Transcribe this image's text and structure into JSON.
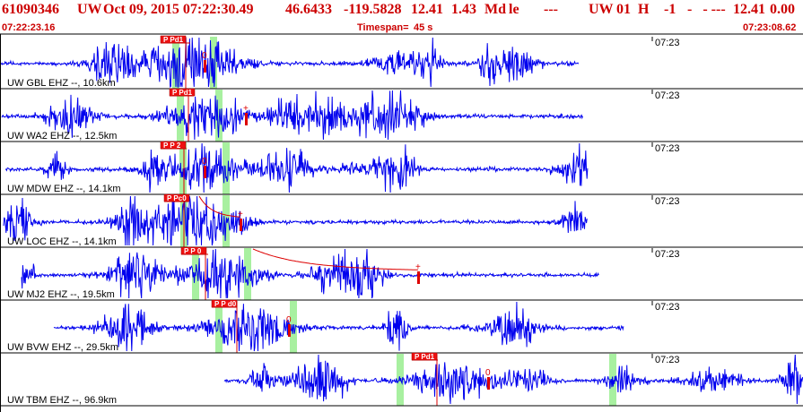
{
  "header": {
    "event_id": "61090346",
    "network": "UW",
    "datetime": "Oct 09, 2015 07:22:30.49",
    "latitude": "46.6433",
    "longitude": "-119.5828",
    "depth": "12.41",
    "magnitude": "1.43",
    "magnitude_type": "Md",
    "status": "le",
    "dashes1": "---",
    "source": "UW",
    "version": "01",
    "type": "H",
    "value1": "-1",
    "dash_group": "-   - ---",
    "depth2": "12.41",
    "value2": "0.00",
    "start_time": "07:22:23.16",
    "timespan_label": "Timespan=",
    "timespan_value": "45 s",
    "end_time": "07:23:08.62"
  },
  "colors": {
    "header_text": "#cc0000",
    "trace": "#0000ee",
    "pick": "#dd0000",
    "pick_label_bg": "#ee1111",
    "window_green": "#a8f0a0",
    "border": "#000000",
    "label_text": "#000000"
  },
  "channels": [
    {
      "label": "UW GBL EHZ --, 10.6km",
      "time_mark": "07:23",
      "pick_label": "P Pd1",
      "coda_marker": "0",
      "has_coda_curve": false,
      "has_plus": false
    },
    {
      "label": "UW WA2 EHZ --, 12.5km",
      "time_mark": "07:23",
      "pick_label": "P Pd1",
      "coda_marker": "+",
      "has_coda_curve": false,
      "has_plus": true
    },
    {
      "label": "UW MDW EHZ --, 14.1km",
      "time_mark": "07:23",
      "pick_label": "P P 2",
      "coda_marker": "0",
      "has_coda_curve": false,
      "has_plus": false
    },
    {
      "label": "UW LOC EHZ --, 14.1km",
      "time_mark": "07:23",
      "pick_label": "P Pc0",
      "coda_marker": "+",
      "has_coda_curve": true,
      "has_plus": true
    },
    {
      "label": "UW MJ2 EHZ --, 19.5km",
      "time_mark": "07:23",
      "pick_label": "P P 0",
      "coda_marker": "+",
      "has_coda_curve": true,
      "has_plus": true
    },
    {
      "label": "UW BVW EHZ --, 29.5km",
      "time_mark": "07:23",
      "pick_label": "P P d0",
      "coda_marker": "0",
      "has_coda_curve": false,
      "has_plus": false
    },
    {
      "label": "UW TBM EHZ --, 96.9km",
      "time_mark": "07:23",
      "pick_label": "P Pd1",
      "coda_marker": "0",
      "has_coda_curve": false,
      "has_plus": false
    }
  ]
}
